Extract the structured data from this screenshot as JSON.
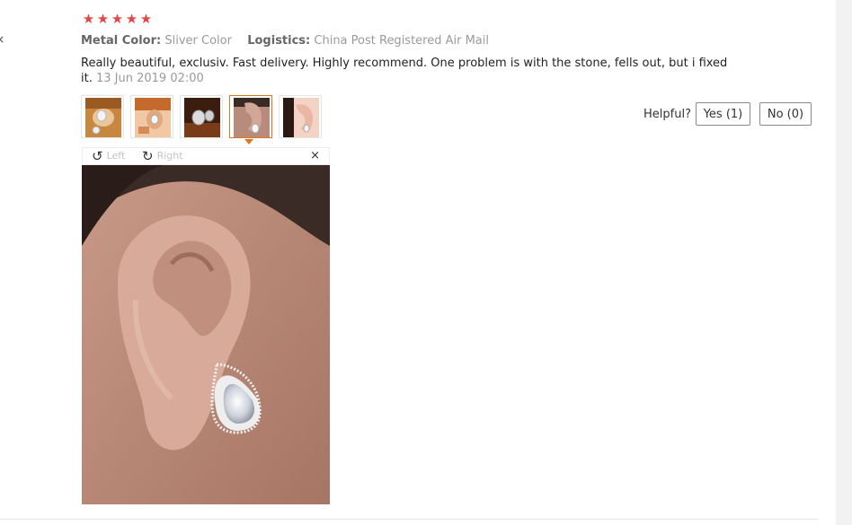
{
  "nav": {
    "back_glyph": "‹"
  },
  "review": {
    "rating_stars": 5,
    "star_glyph": "★",
    "attributes": {
      "metal_color_key": "Metal Color:",
      "metal_color_value": "Sliver Color",
      "logistics_key": "Logistics:",
      "logistics_value": "China Post Registered Air Mail"
    },
    "text": "Really beautiful, exclusiv. Fast delivery. Highly recommend. One problem is with the stone, fells out, but i fixed it.",
    "date": "13 Jun 2019 02:00"
  },
  "thumbnails": {
    "count": 5,
    "active_index": 3
  },
  "viewer": {
    "rotate_left_label": "Left",
    "rotate_right_label": "Right",
    "rotate_left_glyph": "↺",
    "rotate_right_glyph": "↻",
    "close_glyph": "×"
  },
  "helpful": {
    "label": "Helpful?",
    "yes_label": "Yes (1)",
    "no_label": "No (0)"
  },
  "colors": {
    "star": "#e64545",
    "active_thumb_border": "#e0761b"
  }
}
